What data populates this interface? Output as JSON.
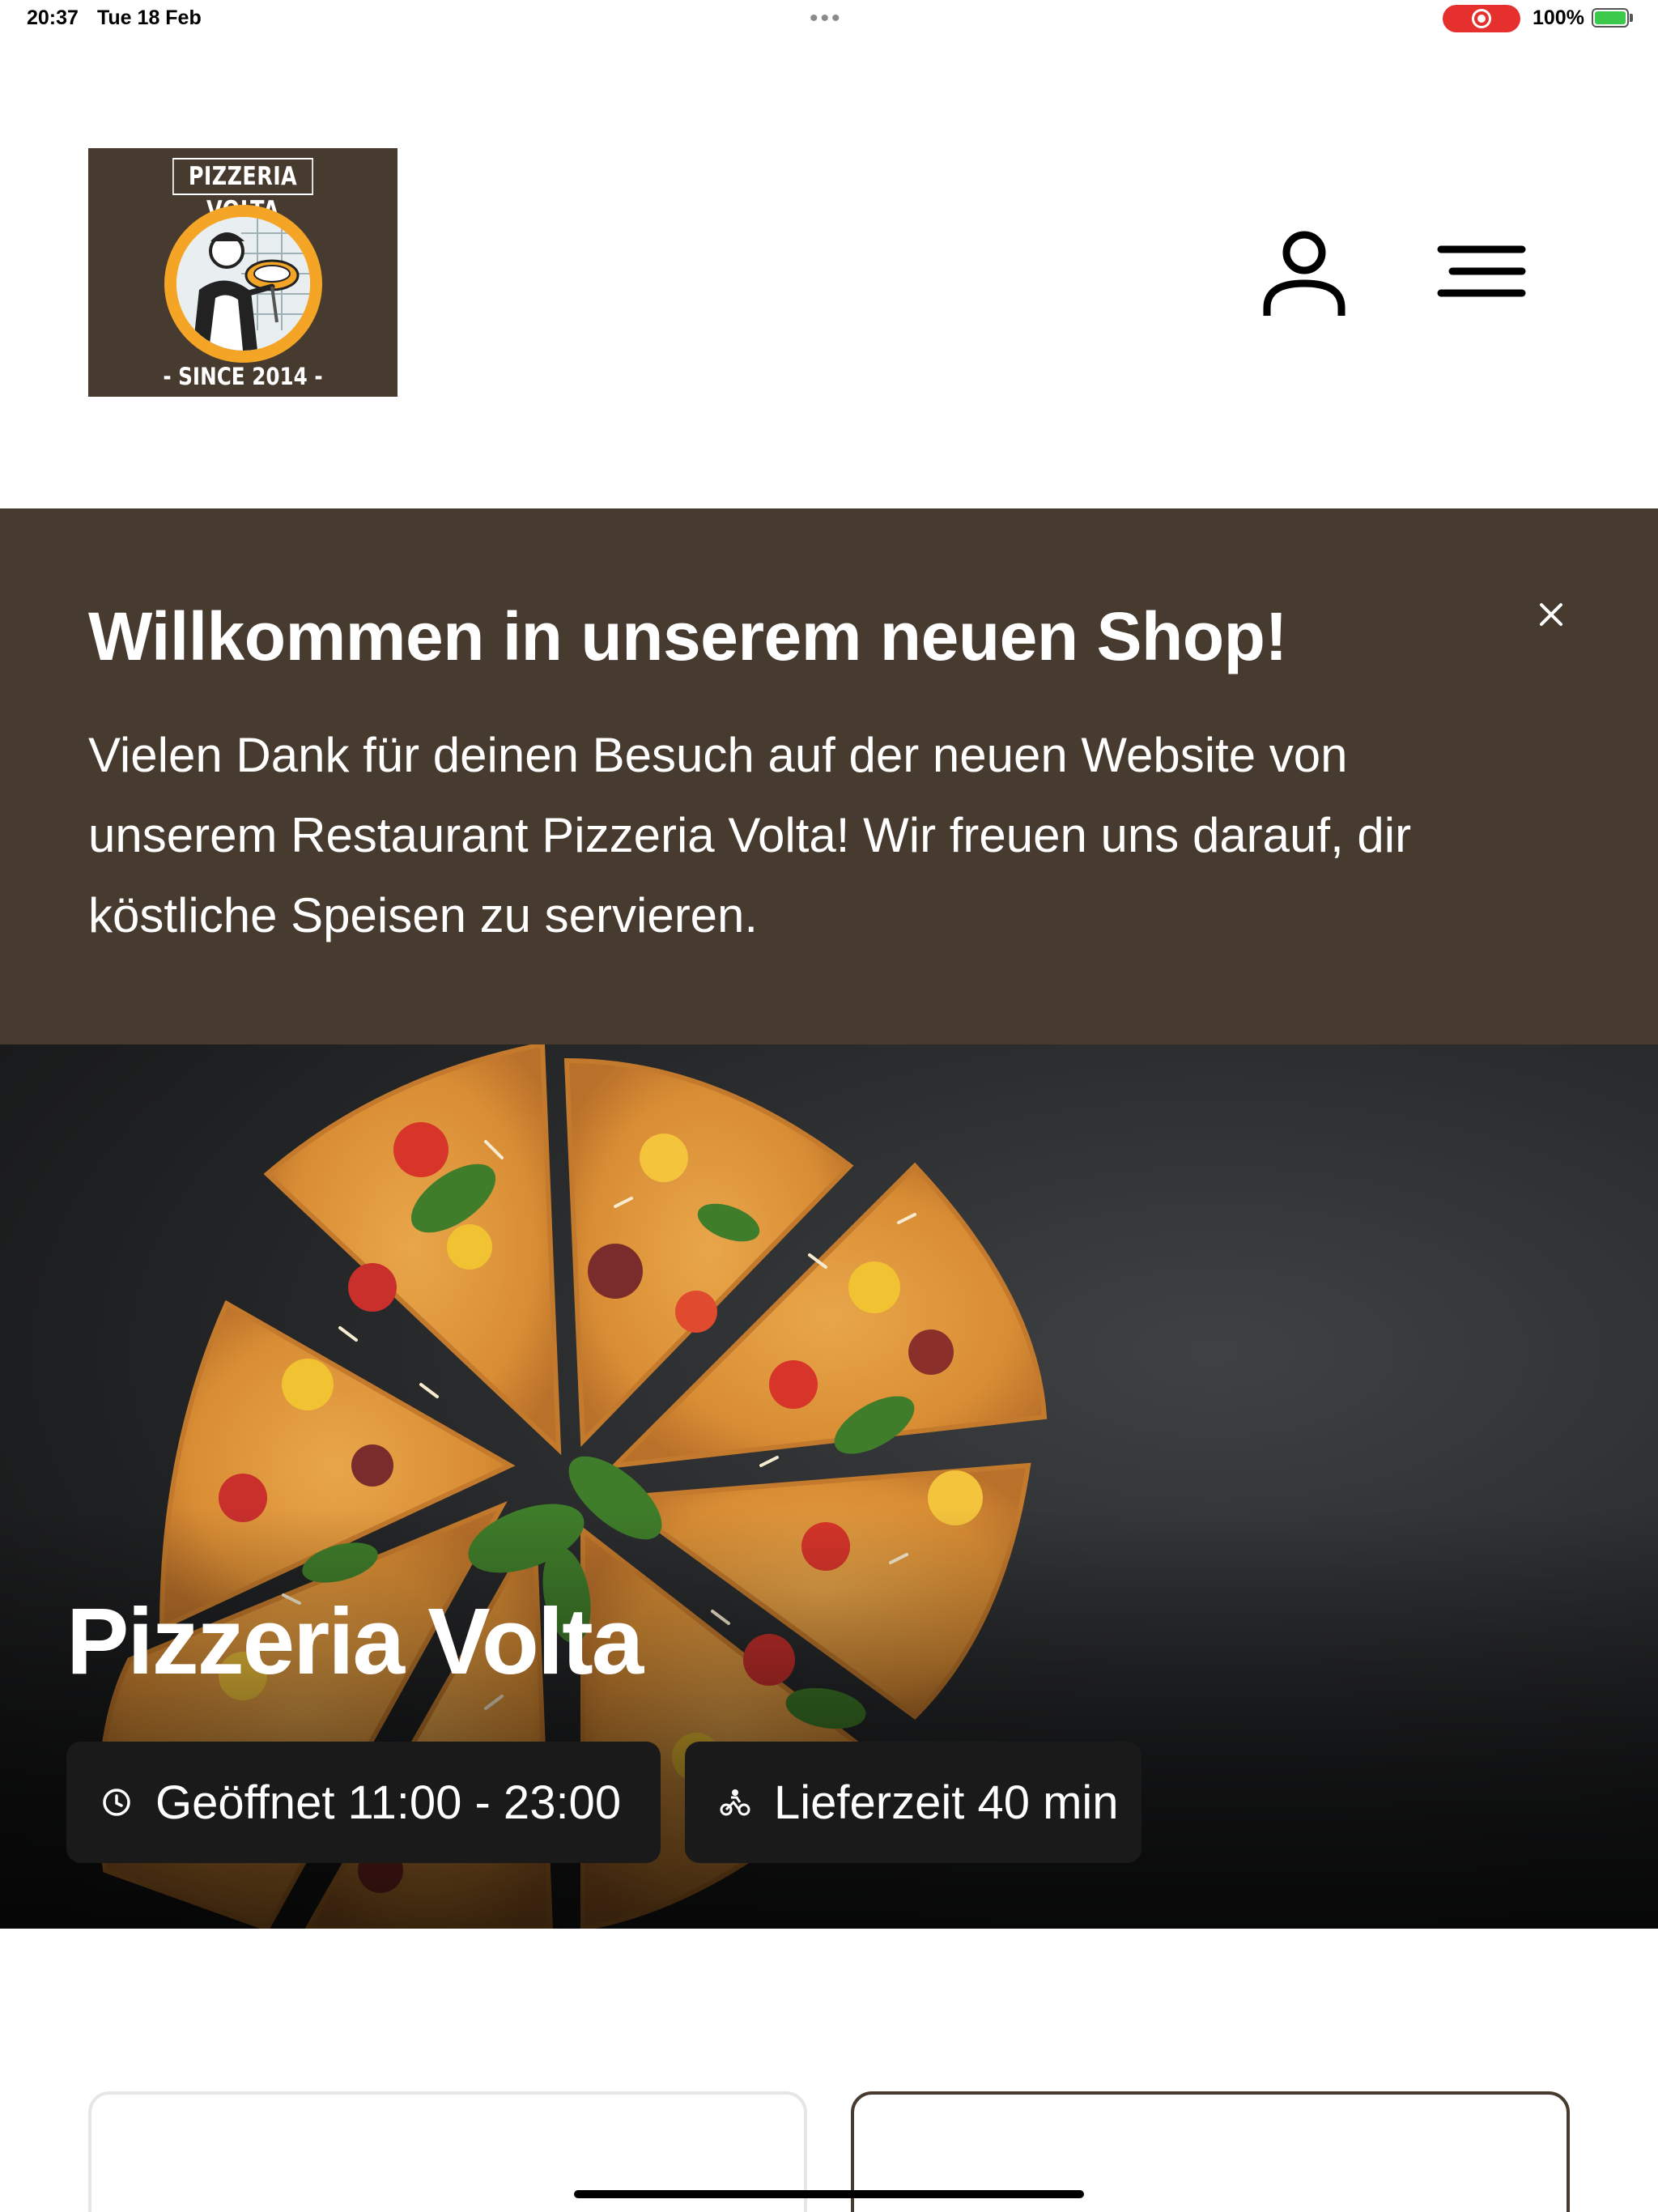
{
  "status_bar": {
    "time": "20:37",
    "date": "Tue 18 Feb",
    "battery": "100%",
    "recording_color": "#e5302e"
  },
  "header": {
    "logo": {
      "title": "PIZZERIA VOLTA",
      "since": "- SINCE 2014 -",
      "background": "#473a2f",
      "accent": "#f4a526"
    },
    "user_icon": "user-icon",
    "menu_icon": "menu-icon"
  },
  "welcome_banner": {
    "title": "Willkommen in unserem neuen Shop!",
    "text": "Vielen Dank für deinen Besuch auf der neuen Website von unserem Restaurant Pizzeria Volta! Wir freuen uns darauf, dir köstliche Speisen zu servieren.",
    "close_icon": "close-icon",
    "background": "#473a2f"
  },
  "hero": {
    "restaurant_name": "Pizzeria Volta",
    "opening_hours": "Geöffnet 11:00 - 23:00",
    "delivery_time": "Lieferzeit 40 min",
    "opening_icon": "clock-icon",
    "delivery_icon": "delivery-bike-icon"
  }
}
